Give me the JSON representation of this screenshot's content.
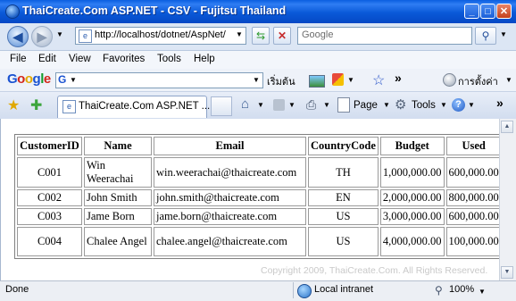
{
  "window": {
    "title": "ThaiCreate.Com ASP.NET - CSV - Fujitsu Thailand",
    "minimize_icon": "minimize-icon",
    "maximize_icon": "maximize-icon",
    "close_icon": "close-icon"
  },
  "address_bar": {
    "url": "http://localhost/dotnet/AspNet/",
    "search_placeholder": "Google"
  },
  "menu": [
    "File",
    "Edit",
    "View",
    "Favorites",
    "Tools",
    "Help"
  ],
  "google_toolbar": {
    "logo": "Google",
    "g_label": "G",
    "start_label": "เริ่มต้น",
    "more_label": "»",
    "settings_label": "การตั้งค่า"
  },
  "tab": {
    "title": "ThaiCreate.Com ASP.NET ...",
    "page_label": "Page",
    "tools_label": "Tools",
    "more_label": "»"
  },
  "table": {
    "headers": [
      "CustomerID",
      "Name",
      "Email",
      "CountryCode",
      "Budget",
      "Used"
    ],
    "rows": [
      [
        "C001",
        "Win Weerachai",
        "win.weerachai@thaicreate.com",
        "TH",
        "1,000,000.00",
        "600,000.00"
      ],
      [
        "C002",
        "John Smith",
        "john.smith@thaicreate.com",
        "EN",
        "2,000,000.00",
        "800,000.00"
      ],
      [
        "C003",
        "Jame Born",
        "jame.born@thaicreate.com",
        "US",
        "3,000,000.00",
        "600,000.00"
      ],
      [
        "C004",
        "Chalee Angel",
        "chalee.angel@thaicreate.com",
        "US",
        "4,000,000.00",
        "100,000.00"
      ]
    ]
  },
  "watermark": "Copyright 2009, ThaiCreate.Com. All Rights Reserved.",
  "status_bar": {
    "status": "Done",
    "zone": "Local intranet",
    "zoom": "100%"
  },
  "colors": {
    "titlebar": "#0a59d8",
    "chrome": "#dce6f4"
  }
}
